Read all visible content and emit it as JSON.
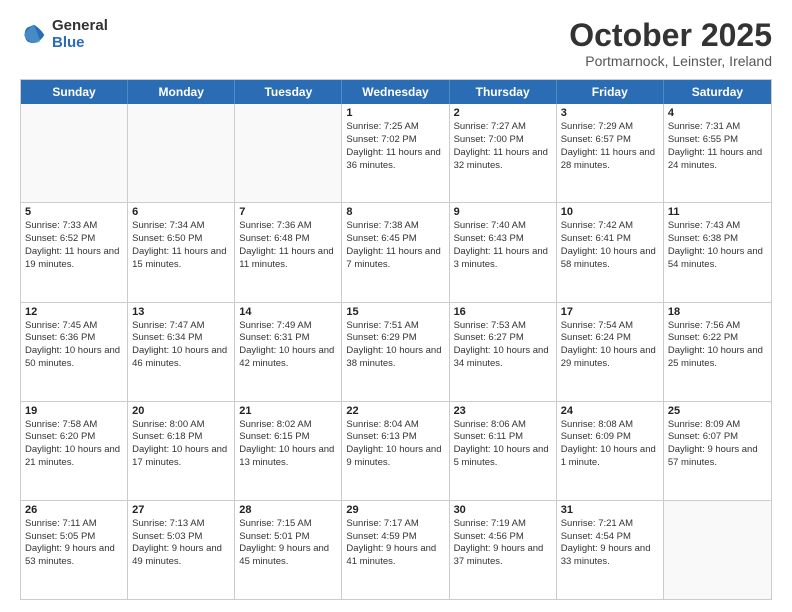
{
  "logo": {
    "general": "General",
    "blue": "Blue"
  },
  "title": "October 2025",
  "location": "Portmarnock, Leinster, Ireland",
  "days": [
    "Sunday",
    "Monday",
    "Tuesday",
    "Wednesday",
    "Thursday",
    "Friday",
    "Saturday"
  ],
  "weeks": [
    [
      {
        "day": "",
        "info": ""
      },
      {
        "day": "",
        "info": ""
      },
      {
        "day": "",
        "info": ""
      },
      {
        "day": "1",
        "info": "Sunrise: 7:25 AM\nSunset: 7:02 PM\nDaylight: 11 hours\nand 36 minutes."
      },
      {
        "day": "2",
        "info": "Sunrise: 7:27 AM\nSunset: 7:00 PM\nDaylight: 11 hours\nand 32 minutes."
      },
      {
        "day": "3",
        "info": "Sunrise: 7:29 AM\nSunset: 6:57 PM\nDaylight: 11 hours\nand 28 minutes."
      },
      {
        "day": "4",
        "info": "Sunrise: 7:31 AM\nSunset: 6:55 PM\nDaylight: 11 hours\nand 24 minutes."
      }
    ],
    [
      {
        "day": "5",
        "info": "Sunrise: 7:33 AM\nSunset: 6:52 PM\nDaylight: 11 hours\nand 19 minutes."
      },
      {
        "day": "6",
        "info": "Sunrise: 7:34 AM\nSunset: 6:50 PM\nDaylight: 11 hours\nand 15 minutes."
      },
      {
        "day": "7",
        "info": "Sunrise: 7:36 AM\nSunset: 6:48 PM\nDaylight: 11 hours\nand 11 minutes."
      },
      {
        "day": "8",
        "info": "Sunrise: 7:38 AM\nSunset: 6:45 PM\nDaylight: 11 hours\nand 7 minutes."
      },
      {
        "day": "9",
        "info": "Sunrise: 7:40 AM\nSunset: 6:43 PM\nDaylight: 11 hours\nand 3 minutes."
      },
      {
        "day": "10",
        "info": "Sunrise: 7:42 AM\nSunset: 6:41 PM\nDaylight: 10 hours\nand 58 minutes."
      },
      {
        "day": "11",
        "info": "Sunrise: 7:43 AM\nSunset: 6:38 PM\nDaylight: 10 hours\nand 54 minutes."
      }
    ],
    [
      {
        "day": "12",
        "info": "Sunrise: 7:45 AM\nSunset: 6:36 PM\nDaylight: 10 hours\nand 50 minutes."
      },
      {
        "day": "13",
        "info": "Sunrise: 7:47 AM\nSunset: 6:34 PM\nDaylight: 10 hours\nand 46 minutes."
      },
      {
        "day": "14",
        "info": "Sunrise: 7:49 AM\nSunset: 6:31 PM\nDaylight: 10 hours\nand 42 minutes."
      },
      {
        "day": "15",
        "info": "Sunrise: 7:51 AM\nSunset: 6:29 PM\nDaylight: 10 hours\nand 38 minutes."
      },
      {
        "day": "16",
        "info": "Sunrise: 7:53 AM\nSunset: 6:27 PM\nDaylight: 10 hours\nand 34 minutes."
      },
      {
        "day": "17",
        "info": "Sunrise: 7:54 AM\nSunset: 6:24 PM\nDaylight: 10 hours\nand 29 minutes."
      },
      {
        "day": "18",
        "info": "Sunrise: 7:56 AM\nSunset: 6:22 PM\nDaylight: 10 hours\nand 25 minutes."
      }
    ],
    [
      {
        "day": "19",
        "info": "Sunrise: 7:58 AM\nSunset: 6:20 PM\nDaylight: 10 hours\nand 21 minutes."
      },
      {
        "day": "20",
        "info": "Sunrise: 8:00 AM\nSunset: 6:18 PM\nDaylight: 10 hours\nand 17 minutes."
      },
      {
        "day": "21",
        "info": "Sunrise: 8:02 AM\nSunset: 6:15 PM\nDaylight: 10 hours\nand 13 minutes."
      },
      {
        "day": "22",
        "info": "Sunrise: 8:04 AM\nSunset: 6:13 PM\nDaylight: 10 hours\nand 9 minutes."
      },
      {
        "day": "23",
        "info": "Sunrise: 8:06 AM\nSunset: 6:11 PM\nDaylight: 10 hours\nand 5 minutes."
      },
      {
        "day": "24",
        "info": "Sunrise: 8:08 AM\nSunset: 6:09 PM\nDaylight: 10 hours\nand 1 minute."
      },
      {
        "day": "25",
        "info": "Sunrise: 8:09 AM\nSunset: 6:07 PM\nDaylight: 9 hours\nand 57 minutes."
      }
    ],
    [
      {
        "day": "26",
        "info": "Sunrise: 7:11 AM\nSunset: 5:05 PM\nDaylight: 9 hours\nand 53 minutes."
      },
      {
        "day": "27",
        "info": "Sunrise: 7:13 AM\nSunset: 5:03 PM\nDaylight: 9 hours\nand 49 minutes."
      },
      {
        "day": "28",
        "info": "Sunrise: 7:15 AM\nSunset: 5:01 PM\nDaylight: 9 hours\nand 45 minutes."
      },
      {
        "day": "29",
        "info": "Sunrise: 7:17 AM\nSunset: 4:59 PM\nDaylight: 9 hours\nand 41 minutes."
      },
      {
        "day": "30",
        "info": "Sunrise: 7:19 AM\nSunset: 4:56 PM\nDaylight: 9 hours\nand 37 minutes."
      },
      {
        "day": "31",
        "info": "Sunrise: 7:21 AM\nSunset: 4:54 PM\nDaylight: 9 hours\nand 33 minutes."
      },
      {
        "day": "",
        "info": ""
      }
    ]
  ]
}
